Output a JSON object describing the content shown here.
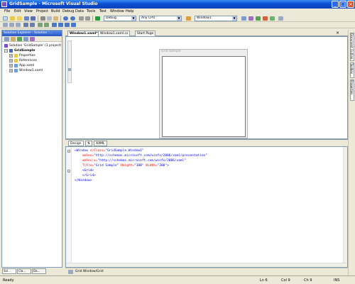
{
  "window": {
    "title": "GridSample - Microsoft Visual Studio"
  },
  "menu": [
    "File",
    "Edit",
    "View",
    "Project",
    "Build",
    "Debug",
    "Data",
    "Tools",
    "Test",
    "Window",
    "Help"
  ],
  "toolbar": {
    "config": "Debug",
    "platform": "Any CPU",
    "find_target": "Window1"
  },
  "solution_explorer": {
    "header": "Solution Explorer - Solution '...",
    "items": [
      {
        "label": "Solution 'GridSample' (1 project)",
        "icon": "solution-icon"
      },
      {
        "label": "GridSample",
        "icon": "project-icon"
      },
      {
        "label": "Properties",
        "icon": "folder-icon"
      },
      {
        "label": "References",
        "icon": "folder-icon"
      },
      {
        "label": "App.xaml",
        "icon": "xaml-file-icon"
      },
      {
        "label": "Window1.xaml",
        "icon": "xaml-file-icon"
      }
    ],
    "tabs": [
      "Sol...",
      "Cla...",
      "Da..."
    ]
  },
  "doc_tabs": [
    "Window1.xaml*",
    "Window1.xaml.cs",
    "Start Page"
  ],
  "designer": {
    "window_title": "Grid Sample"
  },
  "split_tabs": [
    "Design",
    "⇅",
    "XAML"
  ],
  "xaml": {
    "lines": [
      [
        "<Window",
        " x:Class=",
        "\"GridSample.Window1\""
      ],
      [
        "    ",
        "xmlns=",
        "\"http://schemas.microsoft.com/winfx/2006/xaml/presentation\""
      ],
      [
        "    ",
        "xmlns:x=",
        "\"http://schemas.microsoft.com/winfx/2006/xaml\""
      ],
      [
        "    ",
        "Title=",
        "\"Grid Sample\"",
        " Height=",
        "\"300\"",
        " Width=",
        "\"300\"",
        ">"
      ],
      [
        "    <Grid>",
        "",
        ""
      ],
      [
        "    </Grid>",
        "",
        ""
      ],
      [
        "</Window>",
        "",
        ""
      ]
    ]
  },
  "breadcrumb": "Grid  Window/Grid",
  "right_tabs": [
    "Document Outline",
    "Toolbox",
    "Properties"
  ],
  "status": {
    "ready": "Ready",
    "line": "Ln 6",
    "col": "Col 9",
    "ch": "Ch 9",
    "mode": "INS"
  }
}
